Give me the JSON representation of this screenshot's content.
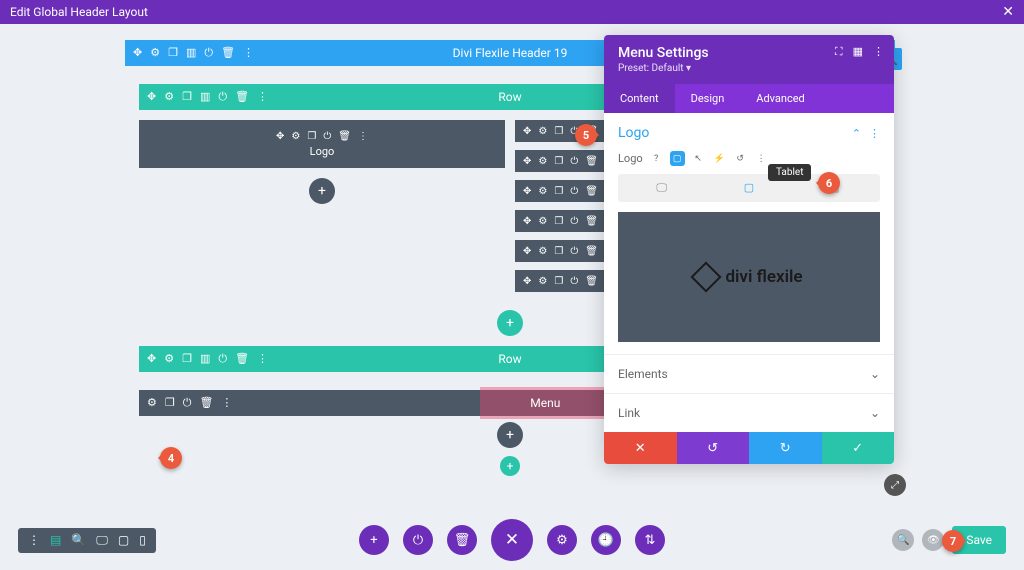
{
  "header": {
    "title": "Edit Global Header Layout"
  },
  "section": {
    "label": "Divi Flexile Header 19"
  },
  "rows": {
    "label": "Row"
  },
  "modules": {
    "logo": "Logo",
    "menu": "Menu"
  },
  "settings": {
    "title": "Menu Settings",
    "preset": "Preset: Default ▾",
    "tabs": {
      "content": "Content",
      "design": "Design",
      "advanced": "Advanced"
    },
    "group": "Logo",
    "field_label": "Logo",
    "tooltip": "Tablet",
    "preview_brand": "divi flexile",
    "accordion": {
      "elements": "Elements",
      "link": "Link"
    }
  },
  "bottom": {
    "save": "Save",
    "dots": "..."
  },
  "callouts": {
    "c4": "4",
    "c5": "5",
    "c6": "6",
    "c7": "7"
  }
}
